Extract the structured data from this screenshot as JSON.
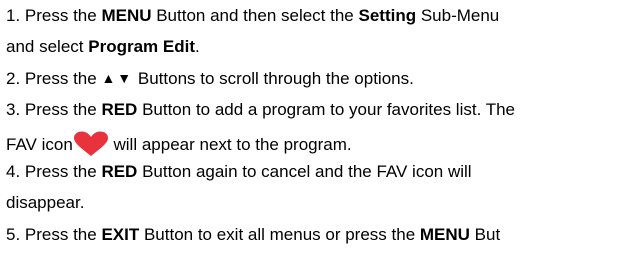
{
  "doc": {
    "l1_a": "1. Press the ",
    "l1_b": "MENU",
    "l1_c": " Button and then select the ",
    "l1_d": "Setting",
    "l1_e": " Sub-Menu",
    "l2_a": "and select ",
    "l2_b": "Program Edit",
    "l2_c": ".",
    "l3_a": "2. Press the ",
    "l3_arrows": "▲▼",
    "l3_c": " Buttons to scroll through the options.",
    "l4_a": "3. Press the ",
    "l4_b": "RED",
    "l4_c": " Button to add a program to your favorites list. The",
    "l5_a": "FAV icon",
    "l5_icon": "heart-icon",
    "l5_c": " will appear next to the program.",
    "l6_a": "4. Press the ",
    "l6_b": "RED",
    "l6_c": " Button again to cancel and the FAV icon will",
    "l7_a": "disappear.",
    "l8_a": "5. Press the ",
    "l8_b": "EXIT",
    "l8_c": " Button to exit all menus or press the ",
    "l8_d": "MENU",
    "l8_e": " But"
  },
  "colors": {
    "heart": "#e8323c"
  }
}
